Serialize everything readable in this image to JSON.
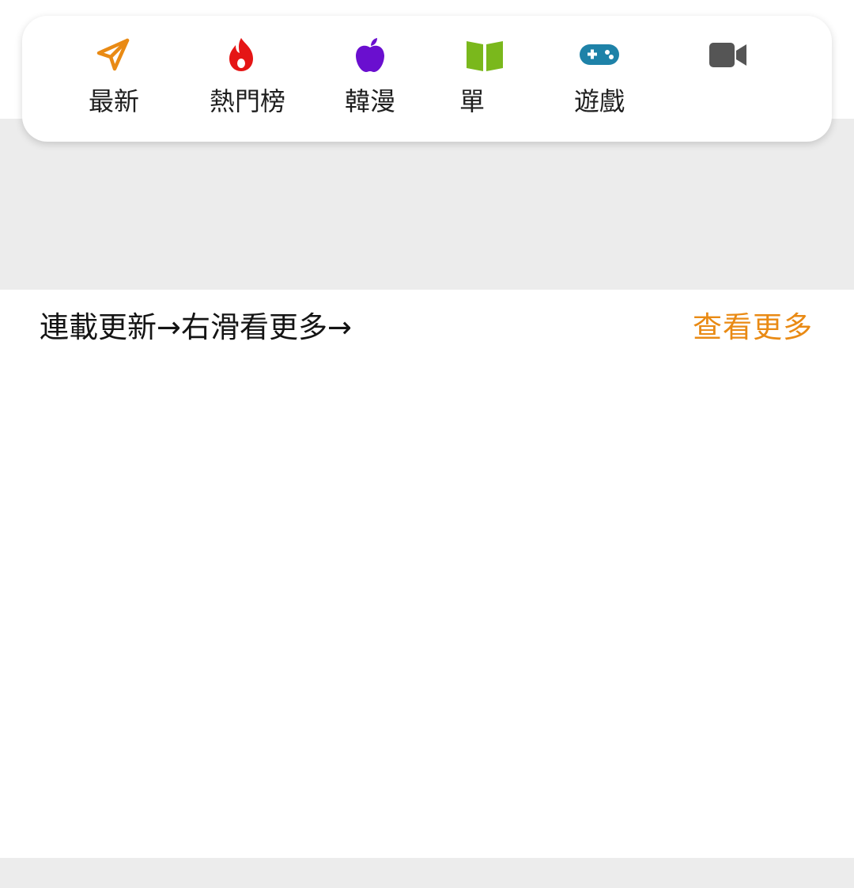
{
  "nav": {
    "items": [
      {
        "label": "最新",
        "icon": "paper-plane-icon",
        "color": "#e98a14"
      },
      {
        "label": "熱門榜",
        "icon": "fire-icon",
        "color": "#e51515"
      },
      {
        "label": "韓漫",
        "icon": "apple-icon",
        "color": "#6a0fcf"
      },
      {
        "label": "單",
        "icon": "open-book-icon",
        "color": "#7ab81c"
      },
      {
        "label": "遊戲",
        "icon": "gamepad-icon",
        "color": "#1e82a8"
      },
      {
        "label": "",
        "icon": "video-camera-icon",
        "color": "#555555"
      }
    ]
  },
  "section": {
    "title": "連載更新→右滑看更多→",
    "more_label": "查看更多",
    "more_color": "#e98a14"
  },
  "colors": {
    "background_band": "#ececec",
    "card": "#ffffff"
  }
}
